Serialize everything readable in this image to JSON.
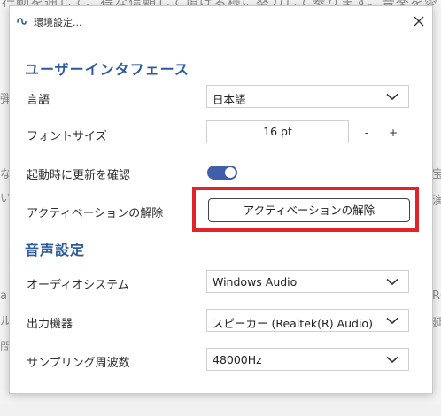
{
  "background": {
    "top_text": "行動を通じて、得な信頼して頂ける様に努力して参ります。音楽を愛す",
    "left_fragments": [
      "弾",
      "な",
      "い",
      "a",
      "ル",
      "問"
    ],
    "right_fragments": [
      "宝",
      "演",
      "RO",
      "延"
    ]
  },
  "dialog": {
    "title": "環境設定...",
    "close_label": "✕"
  },
  "ui_section": {
    "title": "ユーザーインタフェース",
    "language": {
      "label": "言語",
      "value": "日本語"
    },
    "font_size": {
      "label": "フォントサイズ",
      "value": "16 pt",
      "minus": "-",
      "plus": "+"
    },
    "update_check": {
      "label": "起動時に更新を確認",
      "enabled": true
    },
    "deactivation": {
      "label": "アクティベーションの解除",
      "button": "アクティベーションの解除"
    }
  },
  "audio_section": {
    "title": "音声設定",
    "audio_system": {
      "label": "オーディオシステム",
      "value": "Windows Audio"
    },
    "output_device": {
      "label": "出力機器",
      "value": "スピーカー (Realtek(R) Audio)"
    },
    "sample_rate": {
      "label": "サンプリング周波数",
      "value": "48000Hz"
    }
  },
  "colors": {
    "accent": "#2d5b9f",
    "toggle": "#3f5fa8",
    "highlight": "#e1232a"
  }
}
